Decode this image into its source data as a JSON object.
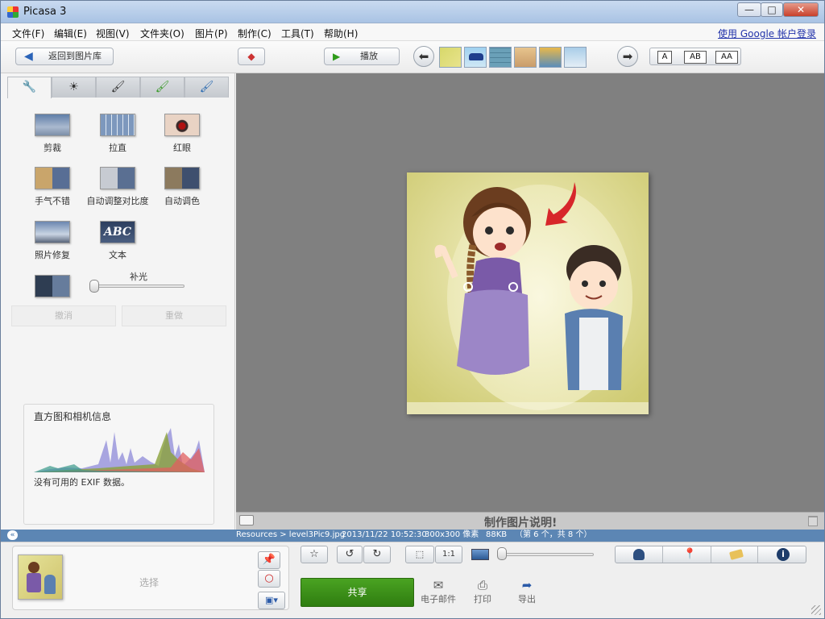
{
  "window": {
    "title": "Picasa 3",
    "minimize": "—",
    "maximize": "□",
    "close": "✕"
  },
  "menu": {
    "items": [
      "文件(F)",
      "编辑(E)",
      "视图(V)",
      "文件夹(O)",
      "图片(P)",
      "制作(C)",
      "工具(T)",
      "帮助(H)"
    ],
    "account_link": "使用 Google 帐户登录"
  },
  "toolbar": {
    "back_label": "返回到图片库",
    "play_label": "播放",
    "font_sizes": [
      "A",
      "AB",
      "AA"
    ]
  },
  "left_panel": {
    "tabs": [
      "wrench-icon",
      "sun-icon",
      "brush-icon",
      "brush-green-icon",
      "brush-blue-icon"
    ],
    "tools": [
      "剪裁",
      "拉直",
      "红眼",
      "手气不错",
      "自动调整对比度",
      "自动调色",
      "照片修复",
      "文本"
    ],
    "fill_light_label": "补光",
    "fill_light_value": 0,
    "text_tool_glyph": "ABC",
    "undo_label": "撤消",
    "redo_label": "重做",
    "histogram_title": "直方图和相机信息",
    "exif_text": "没有可用的 EXIF 数据。"
  },
  "main": {
    "caption_placeholder": "制作图片说明!"
  },
  "infobar": {
    "path": "Resources > level3Pic9.jpg",
    "datetime": "2013/11/22 10:52:30",
    "dims": "300x300 像素",
    "size": "88KB",
    "position": "（第 6 个，共 8 个）"
  },
  "tray": {
    "select_label": "选择",
    "share_label": "共享",
    "email_label": "电子邮件",
    "print_label": "打印",
    "export_label": "导出",
    "zoom_value": 0,
    "one_to_one": "1:1"
  },
  "colors": {
    "accent_blue": "#5c86b4",
    "share_green": "#3a8f18",
    "viewer_gray": "#808080"
  }
}
